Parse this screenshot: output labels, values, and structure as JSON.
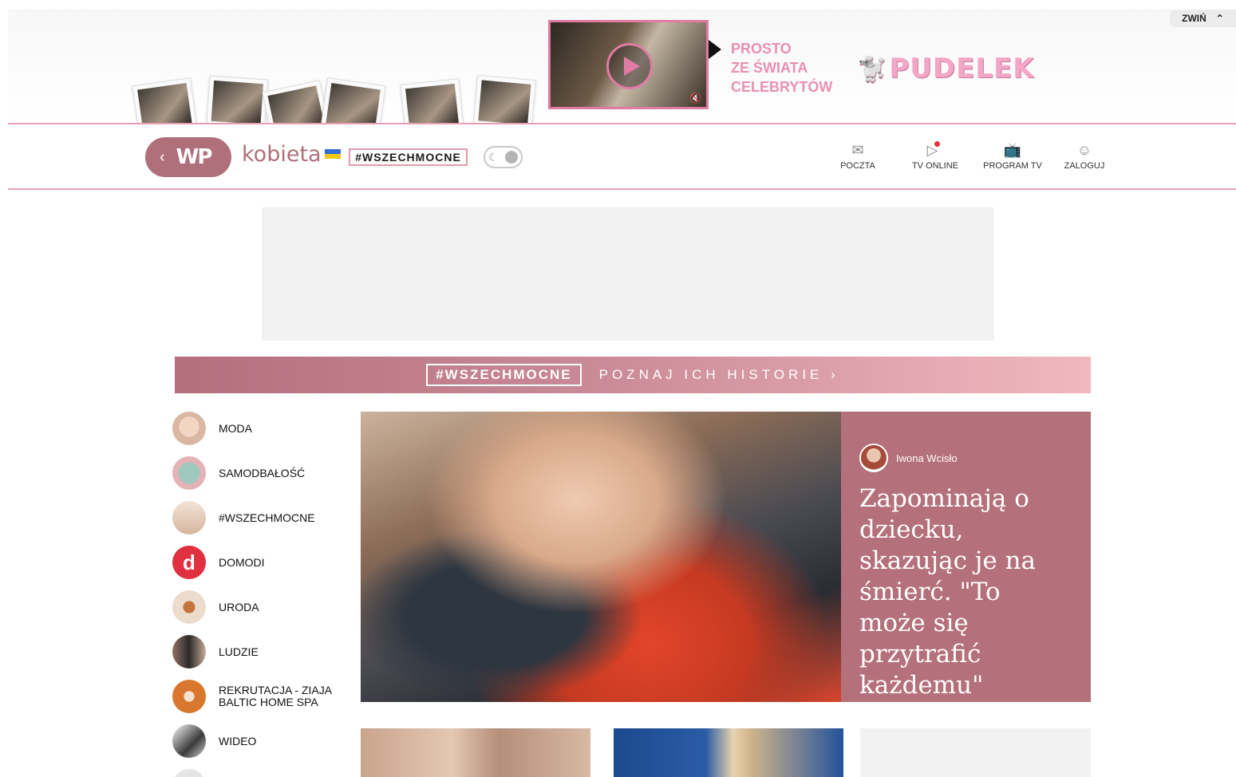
{
  "promo": {
    "collapse_label": "ZWIŃ",
    "tagline_lines": [
      "PROSTO",
      "ZE ŚWIATA",
      "CELEBRYTÓW"
    ],
    "brand": "PUDELEK",
    "colors": {
      "accent": "#e07ba4",
      "text": "#e98fb4"
    },
    "icons": {
      "play": "play-icon",
      "mute": "mute-icon",
      "collapse": "chevron-up-icon"
    }
  },
  "header": {
    "back_icon": "chevron-left-icon",
    "logo_text": "WP",
    "brand": "kobieta",
    "hashtag": "#WSZECHMOCNE",
    "nav": [
      {
        "label": "POCZTA",
        "icon": "mail-icon"
      },
      {
        "label": "TV ONLINE",
        "icon": "tv-play-icon"
      },
      {
        "label": "PROGRAM TV",
        "icon": "tv-icon"
      },
      {
        "label": "ZALOGUJ",
        "icon": "user-icon"
      }
    ]
  },
  "strip": {
    "tag": "#WSZECHMOCNE",
    "cta": "POZNAJ ICH HISTORIE"
  },
  "sidebar": {
    "items": [
      {
        "label": "MODA"
      },
      {
        "label": "SAMODBAŁOŚĆ"
      },
      {
        "label": "#WSZECHMOCNE"
      },
      {
        "label": "DOMODI",
        "avatar_letter": "d"
      },
      {
        "label": "URODA"
      },
      {
        "label": "LUDZIE"
      },
      {
        "label": "REKRUTACJA - ZIAJA BALTIC HOME SPA"
      },
      {
        "label": "WIDEO"
      }
    ]
  },
  "hero": {
    "author": "Iwona Wcisło",
    "title": "Zapominają o dziecku, skazując je na śmierć. \"To może się przytrafić każdemu\"",
    "panel_color": "#b4707b"
  }
}
